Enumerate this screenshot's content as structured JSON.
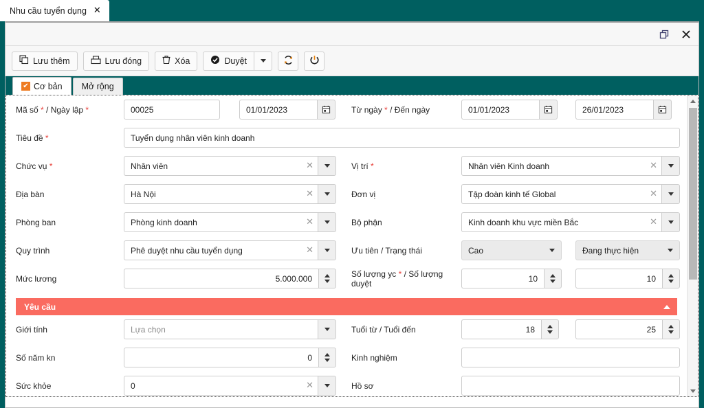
{
  "tab": {
    "label": "Nhu cầu tuyển dụng",
    "close_icon": "close-icon"
  },
  "window": {
    "restore_icon": "restore-window-icon",
    "close_icon": "close-window-icon"
  },
  "toolbar": {
    "buttons": [
      {
        "label": "Lưu thêm",
        "icon": "copy-icon"
      },
      {
        "label": "Lưu đóng",
        "icon": "save-close-icon"
      },
      {
        "label": "Xóa",
        "icon": "trash-icon"
      },
      {
        "label": "Duyệt",
        "icon": "check-circle-icon"
      }
    ],
    "split_caret": "chevron-down-icon",
    "refresh_icon": "refresh-icon",
    "power_icon": "power-icon"
  },
  "form_tabs": [
    {
      "label": "Cơ bản",
      "active": true,
      "check": "✔"
    },
    {
      "label": "Mở rộng",
      "active": false
    }
  ],
  "form": {
    "ma_so": {
      "label": "Mã số",
      "required": true,
      "value": "00025"
    },
    "ngay_lap": {
      "label": "Ngày lập",
      "required": true,
      "value": "01/01/2023",
      "icon": "calendar-icon"
    },
    "tu_ngay": {
      "label": "Từ ngày",
      "required": true,
      "value": "01/01/2023",
      "icon": "calendar-icon"
    },
    "den_ngay": {
      "label": "Đến ngày",
      "required": false,
      "value": "26/01/2023",
      "icon": "calendar-icon"
    },
    "tieu_de": {
      "label": "Tiêu đề",
      "required": true,
      "value": "Tuyển dụng nhân viên kinh doanh"
    },
    "chuc_vu": {
      "label": "Chức vụ",
      "required": true,
      "value": "Nhân viên"
    },
    "vi_tri": {
      "label": "Vị trí",
      "required": true,
      "value": "Nhân viên Kinh doanh"
    },
    "dia_ban": {
      "label": "Địa bàn",
      "required": false,
      "value": "Hà Nội"
    },
    "don_vi": {
      "label": "Đơn vị",
      "required": false,
      "value": "Tập đoàn kinh tế Global"
    },
    "phong_ban": {
      "label": "Phòng ban",
      "required": false,
      "value": "Phòng kinh doanh"
    },
    "bo_phan": {
      "label": "Bộ phận",
      "required": false,
      "value": "Kinh doanh khu vực miền Bắc"
    },
    "quy_trinh": {
      "label": "Quy trình",
      "required": false,
      "value": "Phê duyệt nhu cầu tuyển dụng"
    },
    "uu_tien": {
      "label": "Ưu tiên",
      "value": "Cao"
    },
    "trang_thai": {
      "label": "Trạng thái",
      "value": "Đang thực hiện"
    },
    "uu_tien_trang_thai_label": "Ưu tiên / Trạng thái",
    "muc_luong": {
      "label": "Mức lương",
      "value": "5.000.000"
    },
    "so_luong_yc": {
      "label": "Số lượng yc",
      "required": true,
      "value": "10"
    },
    "so_luong_duyet": {
      "label": "Số lượng duyệt",
      "required": false,
      "value": "10"
    },
    "so_luong_label_prefix": "Số lượng yc",
    "so_luong_label_suffix": " / Số lượng duyệt"
  },
  "section_yeu_cau": {
    "title": "Yêu cầu",
    "collapse_icon": "chevron-up-icon"
  },
  "requirements": {
    "gioi_tinh": {
      "label": "Giới tính",
      "placeholder": "Lựa chọn"
    },
    "tuoi_tu_den_label": "Tuổi từ / Tuổi đến",
    "tuoi_tu": {
      "label": "Tuổi từ",
      "value": "18"
    },
    "tuoi_den": {
      "label": "Tuổi đến",
      "value": "25"
    },
    "so_nam_kn": {
      "label": "Số năm kn",
      "value": "0"
    },
    "kinh_nghiem": {
      "label": "Kinh nghiệm",
      "value": ""
    },
    "suc_khoe": {
      "label": "Sức khỏe",
      "value": "0"
    },
    "ho_so": {
      "label": "Hồ sơ",
      "value": ""
    }
  },
  "labels": {
    "ma_so_ngay_lap": "Mã số",
    "slash": " / ",
    "ngay_lap_text": "Ngày lập",
    "tu_ngay_text": "Từ ngày",
    "den_ngay_text": "Đến ngày"
  },
  "colors": {
    "teal": "#005f60",
    "accent_orange": "#ee7b21",
    "section_red": "#fa6b60",
    "required_red": "#e8403a"
  }
}
